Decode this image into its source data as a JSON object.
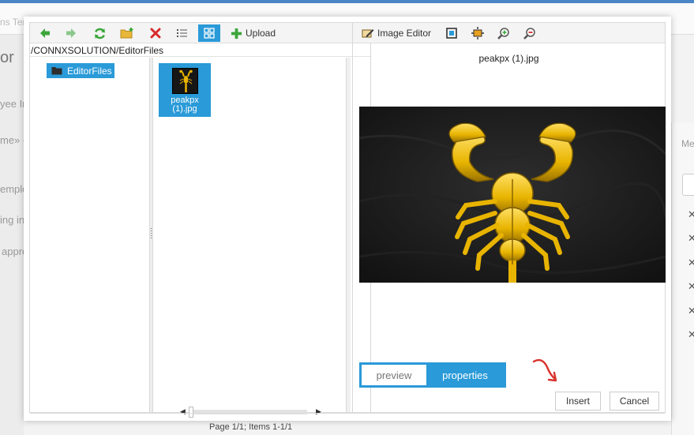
{
  "background": {
    "breadcrumb": "ns Templates  Home",
    "heading_fragment": "or",
    "lines": [
      "yee In",
      "me» «",
      "emplo",
      "ing in",
      "appro"
    ],
    "right_tab": "Me"
  },
  "toolbar": {
    "upload_label": "Upload"
  },
  "path": "/CONNXSOLUTION/EditorFiles",
  "tree": {
    "items": [
      {
        "label": "EditorFiles"
      }
    ]
  },
  "files": {
    "items": [
      {
        "name": "peakpx (1).jpg"
      }
    ],
    "pager": "Page 1/1; Items 1-1/1"
  },
  "preview": {
    "image_editor_label": "Image Editor",
    "file_name": "peakpx (1).jpg",
    "tabs": [
      "preview",
      "properties"
    ],
    "active_tab": "properties"
  },
  "actions": {
    "insert_label": "Insert",
    "cancel_label": "Cancel"
  },
  "colors": {
    "accent": "#2a9ad8",
    "annotation": "#d9322d"
  }
}
